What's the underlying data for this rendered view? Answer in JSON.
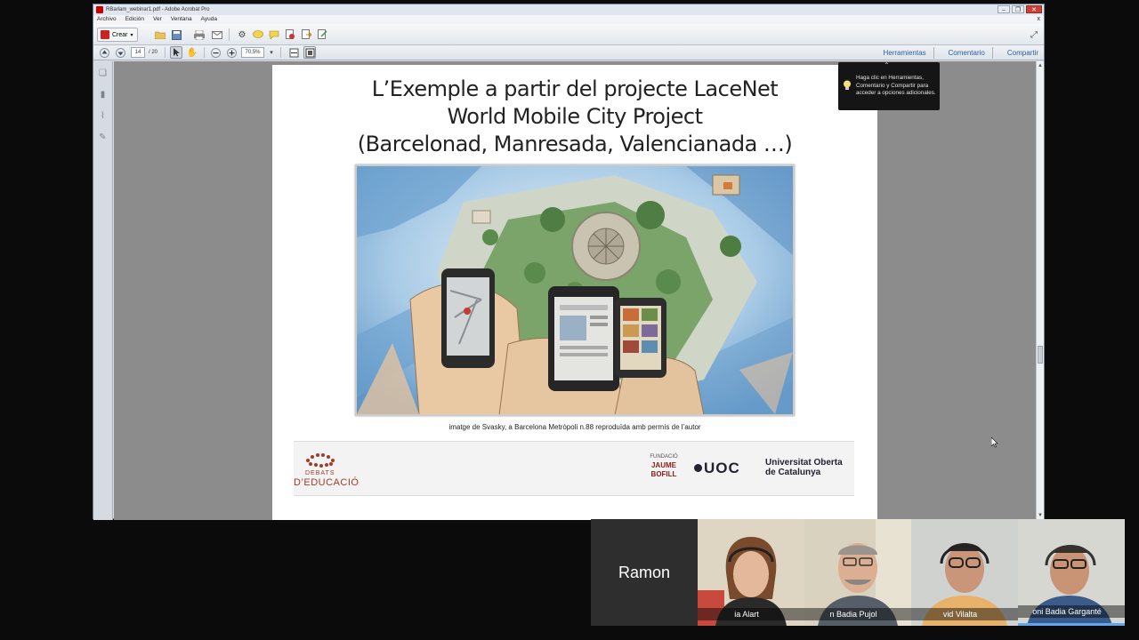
{
  "window": {
    "title": "RBarlam_webinar1.pdf - Adobe Acrobat Pro",
    "menu": [
      "Archivo",
      "Edición",
      "Ver",
      "Ventana",
      "Ayuda"
    ],
    "menu_close": "x"
  },
  "toolbar": {
    "create_label": "Crear",
    "page_current": "14",
    "page_total": "/ 20",
    "zoom": "70,5%",
    "right_links": [
      "Herramientas",
      "Comentario",
      "Compartir"
    ]
  },
  "slide": {
    "title_line1": "L’Exemple a partir del projecte LaceNet",
    "title_line2": "World Mobile City Project",
    "title_line3": "(Barcelonad, Manresada, Valencianada …)",
    "caption": "imatge de Svasky, a Barcelona Metròpoli n.88 reproduïda amb  permís de l’autor",
    "footer": {
      "debats_line1": "DEBATS",
      "debats_line2": "D’EDUCACIÓ",
      "fundacio_line1": "FUNDACIÓ",
      "fundacio_line2": "JAUME",
      "fundacio_line3": "BOFILL",
      "uoc_mark": "UOC",
      "uoc_name_line1": "Universitat Oberta",
      "uoc_name_line2": "de Catalunya"
    }
  },
  "tooltip": {
    "text": "Haga clic en Herramientas, Comentario y Compartir para acceder a opciones adicionales."
  },
  "hangout": {
    "active_speaker": "Ramon",
    "participants": [
      {
        "name": "ia Alart"
      },
      {
        "name": "n Badia Pujol"
      },
      {
        "name": "vid Vilalta"
      },
      {
        "name": "oni Badia Garganté"
      }
    ]
  },
  "colors": {
    "window_bg": "#d8dde4",
    "doc_bg": "#8c8c8c",
    "link": "#2c5e9c",
    "debats_red": "#a23a2a",
    "hangout_selected": "#60a7f0"
  }
}
